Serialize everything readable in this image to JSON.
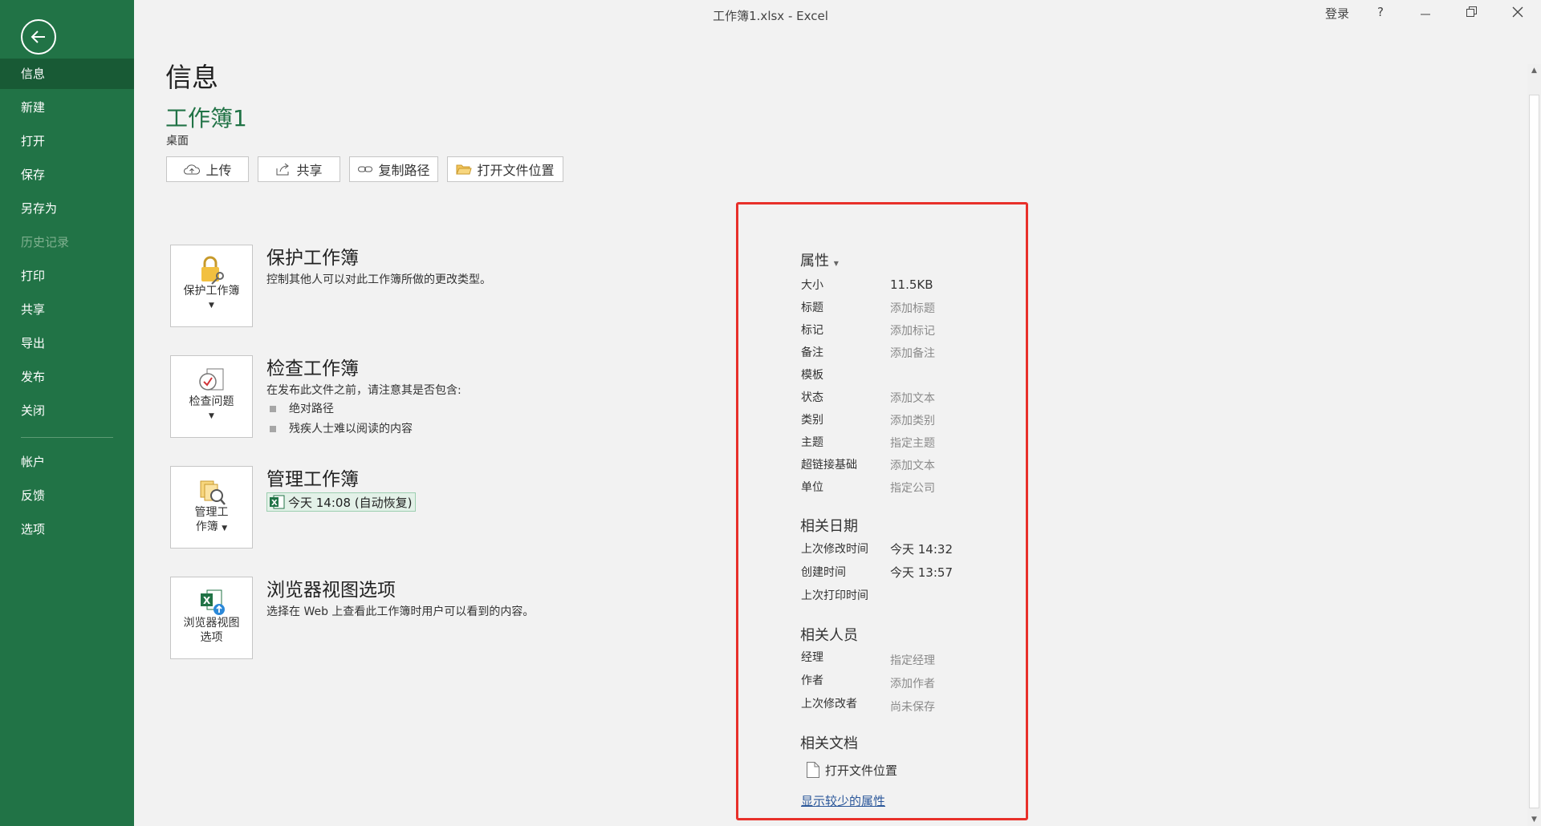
{
  "window": {
    "title": "工作簿1.xlsx  -  Excel",
    "login": "登录",
    "help": "?"
  },
  "nav": {
    "items": [
      {
        "label": "信息"
      },
      {
        "label": "新建"
      },
      {
        "label": "打开"
      },
      {
        "label": "保存"
      },
      {
        "label": "另存为"
      },
      {
        "label": "历史记录"
      },
      {
        "label": "打印"
      },
      {
        "label": "共享"
      },
      {
        "label": "导出"
      },
      {
        "label": "发布"
      },
      {
        "label": "关闭"
      },
      {
        "label": "帐户"
      },
      {
        "label": "反馈"
      },
      {
        "label": "选项"
      }
    ]
  },
  "info": {
    "title": "信息",
    "workbook_name": "工作簿1",
    "location": "桌面",
    "actions": {
      "upload": "上传",
      "share": "共享",
      "copy_path": "复制路径",
      "open_location": "打开文件位置"
    }
  },
  "sections": {
    "protect": {
      "card": "保护工作簿",
      "title": "保护工作簿",
      "desc": "控制其他人可以对此工作簿所做的更改类型。"
    },
    "inspect": {
      "card": "检查问题",
      "title": "检查工作簿",
      "desc": "在发布此文件之前，请注意其是否包含:",
      "bullets": [
        "绝对路径",
        "残疾人士难以阅读的内容"
      ]
    },
    "manage": {
      "card_line1": "管理工",
      "card_line2": "作簿",
      "title": "管理工作簿",
      "version": "今天 14:08 (自动恢复)"
    },
    "browser": {
      "card_line1": "浏览器视图",
      "card_line2": "选项",
      "title": "浏览器视图选项",
      "desc": "选择在 Web 上查看此工作簿时用户可以看到的内容。"
    }
  },
  "properties": {
    "heading": "属性",
    "rows": [
      {
        "label": "大小",
        "value": "11.5KB"
      },
      {
        "label": "标题",
        "value": "添加标题"
      },
      {
        "label": "标记",
        "value": "添加标记"
      },
      {
        "label": "备注",
        "value": "添加备注"
      },
      {
        "label": "模板",
        "value": ""
      },
      {
        "label": "状态",
        "value": "添加文本"
      },
      {
        "label": "类别",
        "value": "添加类别"
      },
      {
        "label": "主题",
        "value": "指定主题"
      },
      {
        "label": "超链接基础",
        "value": "添加文本"
      },
      {
        "label": "单位",
        "value": "指定公司"
      }
    ],
    "dates_heading": "相关日期",
    "dates": [
      {
        "label": "上次修改时间",
        "value": "今天 14:32"
      },
      {
        "label": "创建时间",
        "value": "今天 13:57"
      },
      {
        "label": "上次打印时间",
        "value": ""
      }
    ],
    "people_heading": "相关人员",
    "people": [
      {
        "label": "经理",
        "value": "指定经理"
      },
      {
        "label": "作者",
        "value": "添加作者"
      },
      {
        "label": "上次修改者",
        "value": "尚未保存"
      }
    ],
    "docs_heading": "相关文档",
    "open_location": "打开文件位置",
    "show_fewer": "显示较少的属性"
  },
  "colors": {
    "accent": "#217346",
    "highlight_box": "#e8302a"
  }
}
